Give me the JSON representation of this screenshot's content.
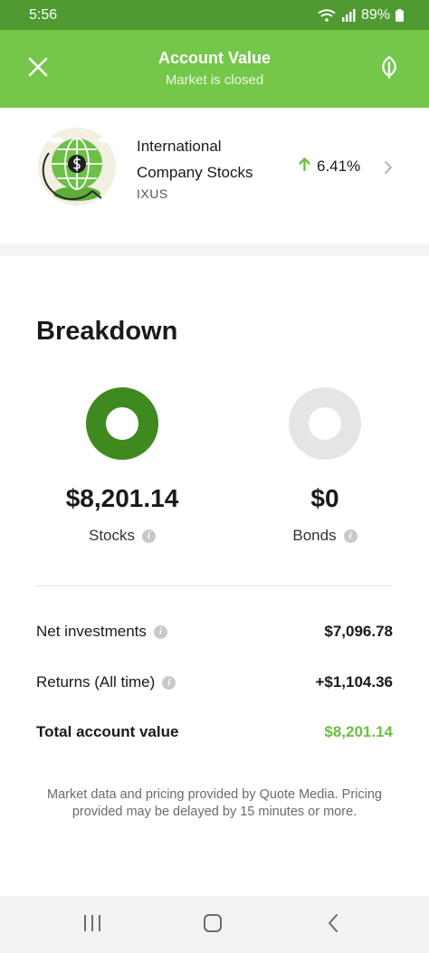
{
  "status_bar": {
    "time": "5:56",
    "battery": "89%"
  },
  "header": {
    "title": "Account Value",
    "subtitle": "Market is closed"
  },
  "fund": {
    "name": "International Company Stocks",
    "ticker": "IXUS",
    "change": "6.41%",
    "change_direction": "up"
  },
  "breakdown": {
    "title": "Breakdown",
    "stocks": {
      "value": "$8,201.14",
      "label": "Stocks",
      "share": 1.0
    },
    "bonds": {
      "value": "$0",
      "label": "Bonds",
      "share": 0.0
    }
  },
  "summary": {
    "net_investments": {
      "label": "Net investments",
      "value": "$7,096.78"
    },
    "returns": {
      "label": "Returns (All time)",
      "value": "+$1,104.36"
    },
    "total": {
      "label": "Total account value",
      "value": "$8,201.14"
    }
  },
  "disclaimer": "Market data and pricing provided by Quote Media. Pricing provided may be delayed by 15 minutes or more.",
  "colors": {
    "status_bar": "#4f9b32",
    "header": "#75c74a",
    "stocks": "#3f8a1f",
    "bonds": "#e5e5e3",
    "positive": "#6bbf45"
  },
  "icons": {
    "close": "close-icon",
    "leaf": "leaf-icon",
    "chevron": "chevron-right-icon",
    "arrow": "arrow-up-icon",
    "info": "info-icon"
  }
}
